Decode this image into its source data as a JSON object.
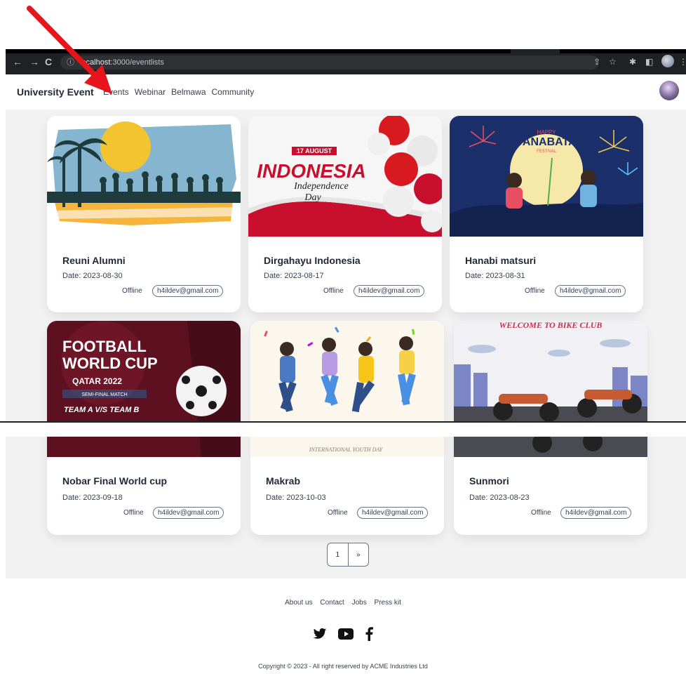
{
  "browser": {
    "url_host": "localhost",
    "url_path": ":3000/eventlists",
    "info_icon": "info-icon"
  },
  "navbar": {
    "brand": "University Event",
    "links": [
      {
        "label": "Events"
      },
      {
        "label": "Webinar"
      },
      {
        "label": "Belmawa"
      },
      {
        "label": "Community"
      }
    ]
  },
  "events": [
    {
      "title": "Reuni Alumni",
      "date": "Date: 2023-08-30",
      "mode": "Offline",
      "email": "h4ildev@gmail.com"
    },
    {
      "title": "Dirgahayu Indonesia",
      "date": "Date: 2023-08-17",
      "mode": "Offline",
      "email": "h4ildev@gmail.com",
      "image_text": {
        "tag": "17 AUGUST",
        "main": "INDONESIA",
        "sub": "Independence",
        "sub2": "Day"
      }
    },
    {
      "title": "Hanabi matsuri",
      "date": "Date: 2023-08-31",
      "mode": "Offline",
      "email": "h4ildev@gmail.com",
      "image_text": {
        "top": "HAPPY",
        "main": "TANABATA",
        "sub": "FESTIVAL"
      }
    },
    {
      "title": "Nobar Final World cup",
      "date": "Date: 2023-09-18",
      "mode": "Offline",
      "email": "h4ildev@gmail.com",
      "image_text": {
        "l1": "FOOTBALL",
        "l2": "WORLD CUP",
        "l3": "QATAR 2022",
        "l4": "SEMI-FINAL MATCH",
        "l5": "TEAM A V/S TEAM B"
      }
    },
    {
      "title": "Makrab",
      "date": "Date: 2023-10-03",
      "mode": "Offline",
      "email": "h4ildev@gmail.com",
      "image_text": {
        "caption": "INTERNATIONAL YOUTH DAY"
      }
    },
    {
      "title": "Sunmori",
      "date": "Date: 2023-08-23",
      "mode": "Offline",
      "email": "h4ildev@gmail.com",
      "image_text": {
        "main": "WELCOME TO BIKE CLUB"
      }
    }
  ],
  "pagination": {
    "current": "1",
    "next": "»"
  },
  "footer": {
    "links": [
      "About us",
      "Contact",
      "Jobs",
      "Press kit"
    ],
    "social": [
      "twitter-icon",
      "youtube-icon",
      "facebook-icon"
    ],
    "copyright": "Copyright © 2023 - All right reserved by ACME Industries Ltd"
  },
  "colors": {
    "annotation_arrow": "#e8141b",
    "chrome_bg": "#202124",
    "content_bg": "#f2f2f2"
  }
}
